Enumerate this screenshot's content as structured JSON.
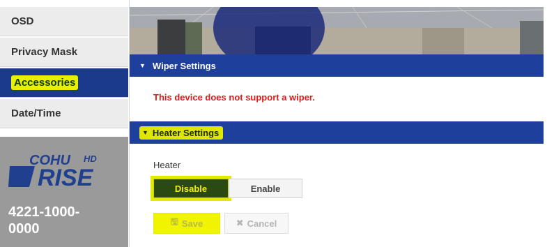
{
  "sidebar": {
    "items": [
      {
        "label": "OSD"
      },
      {
        "label": "Privacy Mask"
      },
      {
        "label": "Accessories"
      },
      {
        "label": "Date/Time"
      }
    ],
    "brand": {
      "logo_text": "COHU",
      "logo_suffix": "HD",
      "logo_subtext": "RISE",
      "model_line1": "4221-1000-",
      "model_line2": "0000"
    }
  },
  "wiper": {
    "title": "Wiper Settings",
    "message": "This device does not support a wiper."
  },
  "heater": {
    "title": "Heater Settings",
    "field_label": "Heater",
    "options": [
      {
        "label": "Disable"
      },
      {
        "label": "Enable"
      }
    ],
    "selected": "Disable"
  },
  "actions": {
    "save_label": "Save",
    "cancel_label": "Cancel"
  },
  "icons": {
    "section_toggle": "caret-down-icon",
    "save": "floppy-disk-icon",
    "cancel": "x-icon"
  },
  "colors": {
    "accent": "#1e3f9b",
    "highlight": "#e3ea00",
    "error": "#e21a1a"
  }
}
